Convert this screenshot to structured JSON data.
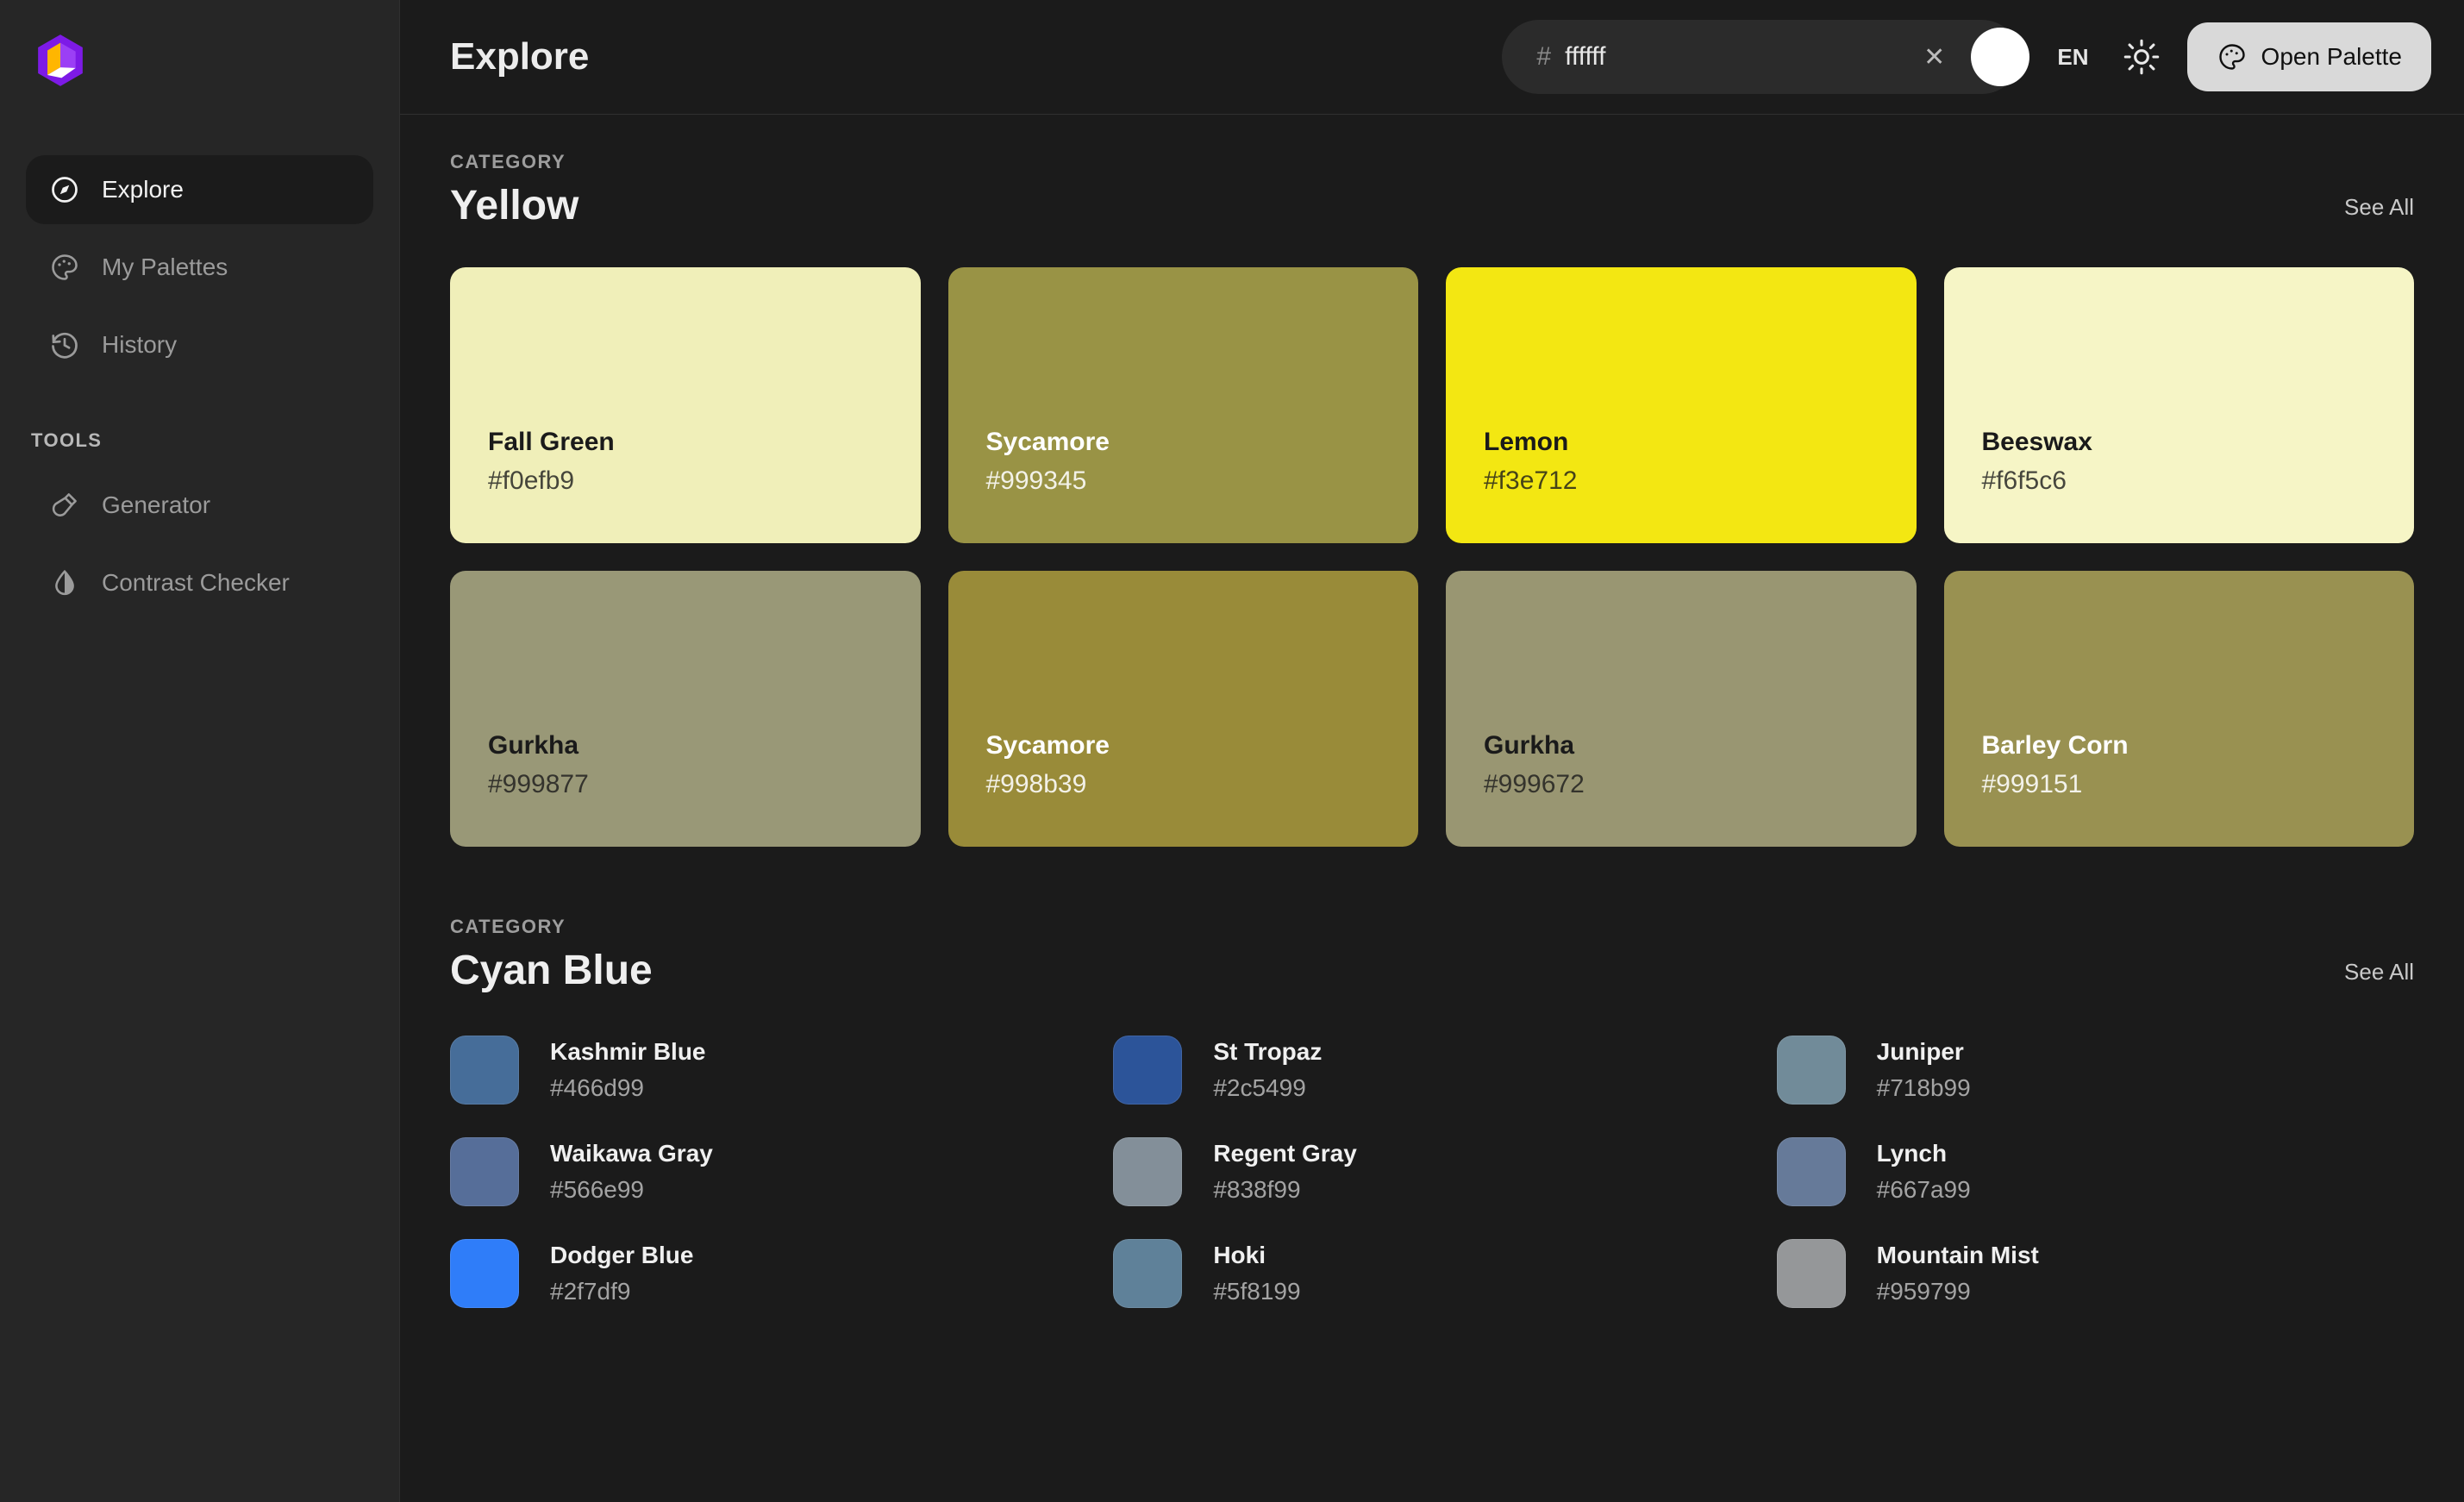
{
  "app": {
    "logo_icon": "cube-logo-icon",
    "brand_colors": {
      "purple": "#7d1ae6",
      "purple_light": "#9b3ff5",
      "yellow": "#ffb600",
      "white": "#ffffff"
    }
  },
  "sidebar": {
    "items": [
      {
        "label": "Explore",
        "icon": "compass-icon",
        "active": true
      },
      {
        "label": "My Palettes",
        "icon": "palette-icon",
        "active": false
      },
      {
        "label": "History",
        "icon": "history-icon",
        "active": false
      }
    ],
    "tools_label": "TOOLS",
    "tools": [
      {
        "label": "Generator",
        "icon": "brush-icon"
      },
      {
        "label": "Contrast Checker",
        "icon": "contrast-droplet-icon"
      }
    ]
  },
  "header": {
    "title": "Explore",
    "color_field": {
      "hash_prefix": "#",
      "value": "ffffff",
      "placeholder": "ffffff",
      "clear_icon": "close-icon",
      "swatch_color": "#ffffff"
    },
    "language": "EN",
    "theme_icon": "sun-icon",
    "open_palette_label": "Open Palette",
    "open_palette_icon": "palette-icon"
  },
  "sections": [
    {
      "category_label": "CATEGORY",
      "name": "Yellow",
      "see_all": "See All",
      "layout": "cards",
      "cards": [
        {
          "name": "Fall Green",
          "hex": "#f0efb9",
          "text_color": "#1a1a1a"
        },
        {
          "name": "Sycamore",
          "hex": "#999345",
          "text_color": "#ffffff"
        },
        {
          "name": "Lemon",
          "hex": "#f3e712",
          "text_color": "#1a1a1a"
        },
        {
          "name": "Beeswax",
          "hex": "#f6f5c6",
          "text_color": "#1a1a1a"
        },
        {
          "name": "Gurkha",
          "hex": "#999877",
          "text_color": "#1a1a1a"
        },
        {
          "name": "Sycamore",
          "hex": "#998b39",
          "text_color": "#ffffff"
        },
        {
          "name": "Gurkha",
          "hex": "#999672",
          "text_color": "#1a1a1a"
        },
        {
          "name": "Barley Corn",
          "hex": "#999151",
          "text_color": "#ffffff"
        }
      ]
    },
    {
      "category_label": "CATEGORY",
      "name": "Cyan Blue",
      "see_all": "See All",
      "layout": "list",
      "items": [
        {
          "name": "Kashmir Blue",
          "hex": "#466d99"
        },
        {
          "name": "St Tropaz",
          "hex": "#2c5499"
        },
        {
          "name": "Juniper",
          "hex": "#718b99"
        },
        {
          "name": "Waikawa Gray",
          "hex": "#566e99"
        },
        {
          "name": "Regent Gray",
          "hex": "#838f99"
        },
        {
          "name": "Lynch",
          "hex": "#667a99"
        },
        {
          "name": "Dodger Blue",
          "hex": "#2f7df9"
        },
        {
          "name": "Hoki",
          "hex": "#5f8199"
        },
        {
          "name": "Mountain Mist",
          "hex": "#959799"
        }
      ]
    }
  ]
}
